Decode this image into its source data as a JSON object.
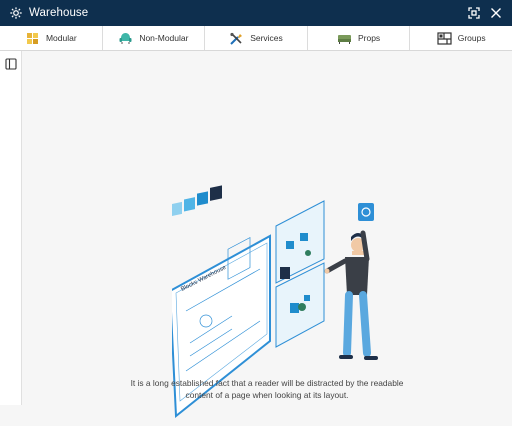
{
  "window": {
    "title": "Warehouse",
    "logo_icon": "gear-icon",
    "maximize_icon": "maximize-icon",
    "close_icon": "close-icon"
  },
  "tabs": [
    {
      "label": "Modular",
      "icon": "modular-chair-icon"
    },
    {
      "label": "Non-Modular",
      "icon": "armchair-icon"
    },
    {
      "label": "Services",
      "icon": "tools-icon"
    },
    {
      "label": "Props",
      "icon": "sofa-icon"
    },
    {
      "label": "Groups",
      "icon": "layout-icon"
    }
  ],
  "sidebar": {
    "toggle_icon": "sidebar-toggle-icon"
  },
  "illustration": {
    "panel_label": "Blocks Warehouse"
  },
  "empty_state": {
    "caption_line1": "It is a long established fact that a reader will be distracted by the readable",
    "caption_line2": "content of a page when looking at its layout."
  },
  "colors": {
    "titlebar": "#0e2f4e",
    "accent": "#2e8fd6",
    "background": "#f6f6f6"
  }
}
